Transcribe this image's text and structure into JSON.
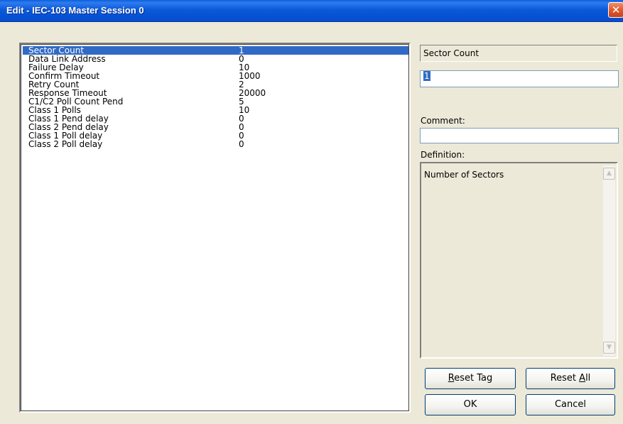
{
  "window": {
    "title": "Edit - IEC-103 Master Session 0",
    "close_glyph": "✕"
  },
  "list": {
    "rows": [
      {
        "name": "Sector Count",
        "value": "1",
        "selected": true
      },
      {
        "name": "Data Link Address",
        "value": "0"
      },
      {
        "name": "Failure Delay",
        "value": "10"
      },
      {
        "name": "Confirm Timeout",
        "value": "1000"
      },
      {
        "name": "Retry Count",
        "value": "2"
      },
      {
        "name": "Response Timeout",
        "value": "20000"
      },
      {
        "name": "C1/C2 Poll Count Pend",
        "value": "5"
      },
      {
        "name": "Class 1 Polls",
        "value": "10"
      },
      {
        "name": "Class 1 Pend delay",
        "value": "0"
      },
      {
        "name": "Class 2 Pend delay",
        "value": "0"
      },
      {
        "name": "Class 1 Poll delay",
        "value": "0"
      },
      {
        "name": "Class 2 Poll delay",
        "value": "0"
      }
    ]
  },
  "editor": {
    "field_title": "Sector Count",
    "value": "1",
    "comment_label": "Comment:",
    "comment_value": "",
    "definition_label": "Definition:",
    "definition_text": "Number of Sectors"
  },
  "buttons": {
    "reset_tag": {
      "pre": "",
      "ul": "R",
      "post": "eset Tag"
    },
    "reset_all": {
      "pre": "Reset ",
      "ul": "A",
      "post": "ll"
    },
    "ok": "OK",
    "cancel": "Cancel"
  },
  "icons": {
    "scroll_up": "scroll-up-arrow-icon",
    "scroll_down": "scroll-down-arrow-icon",
    "close": "close-icon"
  },
  "colors": {
    "title_bar": "#0a5ad8",
    "selection": "#316ac5",
    "dialog_bg": "#ece9d8"
  }
}
